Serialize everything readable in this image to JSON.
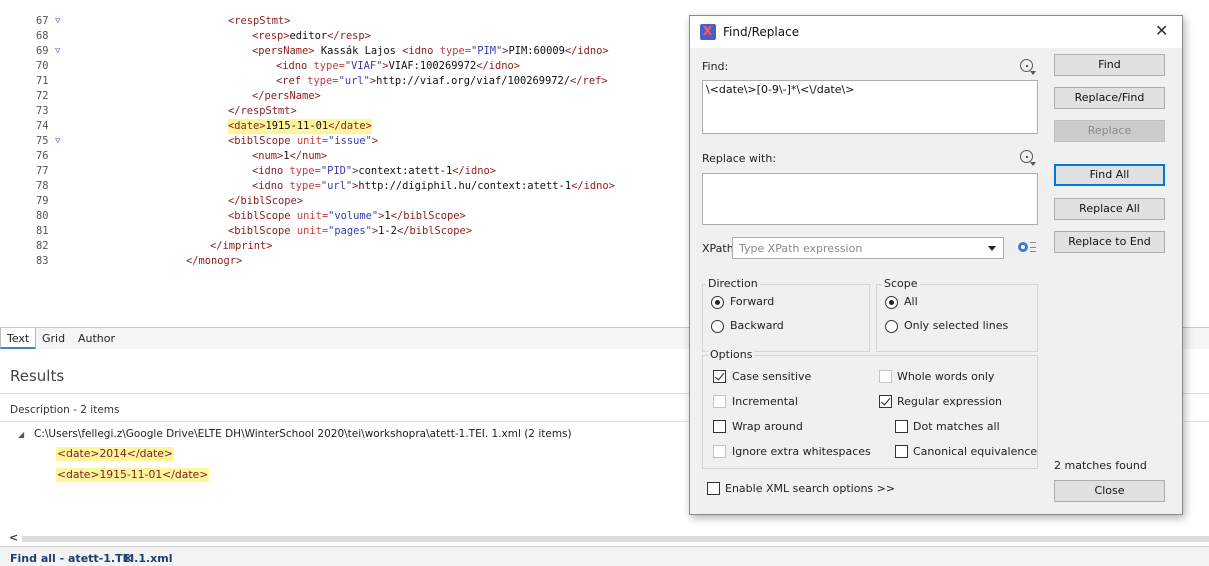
{
  "editor": {
    "lines": [
      {
        "num": "67",
        "fold": true,
        "indent": 228,
        "parts": [
          [
            "tg",
            "<respStmt>"
          ]
        ]
      },
      {
        "num": "68",
        "fold": false,
        "indent": 252,
        "parts": [
          [
            "tg",
            "<resp>"
          ],
          [
            "tx",
            "editor"
          ],
          [
            "tg",
            "</resp>"
          ]
        ]
      },
      {
        "num": "69",
        "fold": true,
        "indent": 252,
        "parts": [
          [
            "tg",
            "<persName>"
          ],
          [
            "tx",
            " Kassák Lajos "
          ],
          [
            "tg",
            "<idno "
          ],
          [
            "an",
            "type="
          ],
          [
            "av",
            "\"PIM\""
          ],
          [
            "tg",
            ">"
          ],
          [
            "tx",
            "PIM:60009"
          ],
          [
            "tg",
            "</idno>"
          ]
        ]
      },
      {
        "num": "70",
        "fold": false,
        "indent": 276,
        "parts": [
          [
            "tg",
            "<idno "
          ],
          [
            "an",
            "type="
          ],
          [
            "av",
            "\"VIAF\""
          ],
          [
            "tg",
            ">"
          ],
          [
            "tx",
            "VIAF:100269972"
          ],
          [
            "tg",
            "</idno>"
          ]
        ]
      },
      {
        "num": "71",
        "fold": false,
        "indent": 276,
        "parts": [
          [
            "tg",
            "<ref "
          ],
          [
            "an",
            "type="
          ],
          [
            "av",
            "\"url\""
          ],
          [
            "tg",
            ">"
          ],
          [
            "tx",
            "http://viaf.org/viaf/100269972/"
          ],
          [
            "tg",
            "</ref>"
          ]
        ]
      },
      {
        "num": "72",
        "fold": false,
        "indent": 252,
        "parts": [
          [
            "tg",
            "</persName>"
          ]
        ]
      },
      {
        "num": "73",
        "fold": false,
        "indent": 228,
        "parts": [
          [
            "tg",
            "</respStmt>"
          ]
        ]
      },
      {
        "num": "74",
        "fold": false,
        "indent": 228,
        "highlight": true,
        "parts": [
          [
            "tg",
            "<date>"
          ],
          [
            "tx",
            "1915-11-01"
          ],
          [
            "tg",
            "</date>"
          ]
        ]
      },
      {
        "num": "75",
        "fold": true,
        "indent": 228,
        "parts": [
          [
            "tg",
            "<biblScope "
          ],
          [
            "an",
            "unit="
          ],
          [
            "av",
            "\"issue\""
          ],
          [
            "tg",
            ">"
          ]
        ]
      },
      {
        "num": "76",
        "fold": false,
        "indent": 252,
        "parts": [
          [
            "tg",
            "<num>"
          ],
          [
            "tx",
            "1"
          ],
          [
            "tg",
            "</num>"
          ]
        ]
      },
      {
        "num": "77",
        "fold": false,
        "indent": 252,
        "parts": [
          [
            "tg",
            "<idno "
          ],
          [
            "an",
            "type="
          ],
          [
            "av",
            "\"PID\""
          ],
          [
            "tg",
            ">"
          ],
          [
            "tx",
            "context:atett-1"
          ],
          [
            "tg",
            "</idno>"
          ]
        ]
      },
      {
        "num": "78",
        "fold": false,
        "indent": 252,
        "parts": [
          [
            "tg",
            "<idno "
          ],
          [
            "an",
            "type="
          ],
          [
            "av",
            "\"url\""
          ],
          [
            "tg",
            ">"
          ],
          [
            "tx",
            "http://digiphil.hu/context:atett-1"
          ],
          [
            "tg",
            "</idno>"
          ]
        ]
      },
      {
        "num": "79",
        "fold": false,
        "indent": 228,
        "parts": [
          [
            "tg",
            "</biblScope>"
          ]
        ]
      },
      {
        "num": "80",
        "fold": false,
        "indent": 228,
        "parts": [
          [
            "tg",
            "<biblScope "
          ],
          [
            "an",
            "unit="
          ],
          [
            "av",
            "\"volume\""
          ],
          [
            "tg",
            ">"
          ],
          [
            "tx",
            "1"
          ],
          [
            "tg",
            "</biblScope>"
          ]
        ]
      },
      {
        "num": "81",
        "fold": false,
        "indent": 228,
        "parts": [
          [
            "tg",
            "<biblScope "
          ],
          [
            "an",
            "unit="
          ],
          [
            "av",
            "\"pages\""
          ],
          [
            "tg",
            ">"
          ],
          [
            "tx",
            "1-2"
          ],
          [
            "tg",
            "</biblScope>"
          ]
        ]
      },
      {
        "num": "82",
        "fold": false,
        "indent": 210,
        "parts": [
          [
            "tg",
            "</imprint>"
          ]
        ]
      },
      {
        "num": "83",
        "fold": false,
        "indent": 186,
        "parts": [
          [
            "tg",
            "</monogr>"
          ]
        ]
      }
    ]
  },
  "modes": {
    "text": "Text",
    "grid": "Grid",
    "author": "Author"
  },
  "results": {
    "title": "Results",
    "description": "Description - 2 items",
    "path": "C:\\Users\\fellegi.z\\Google Drive\\ELTE DH\\WinterSchool 2020\\tei\\workshopra\\atett-1.TEI. 1.xml (2 items)",
    "matches": [
      "<date>2014</date>",
      "<date>1915-11-01</date>"
    ]
  },
  "bottom_tab": {
    "label": "Find all - atett-1.TEI.1.xml",
    "close": "×"
  },
  "dialog": {
    "title": "Find/Replace",
    "close": "✕",
    "find_label": "Find:",
    "find_value": "\\<date\\>[0-9\\-]*\\<\\/date\\>",
    "replace_label": "Replace with:",
    "replace_value": "",
    "xpath_label": "XPath:",
    "xpath_placeholder": "Type XPath expression",
    "buttons": {
      "find": "Find",
      "replace_find": "Replace/Find",
      "replace": "Replace",
      "find_all": "Find All",
      "replace_all": "Replace All",
      "replace_to_end": "Replace to End",
      "close": "Close"
    },
    "direction": {
      "title": "Direction",
      "forward": "Forward",
      "backward": "Backward",
      "selected": "forward"
    },
    "scope": {
      "title": "Scope",
      "all": "All",
      "only_selected": "Only selected lines",
      "selected": "all"
    },
    "options": {
      "title": "Options",
      "case_sensitive": {
        "label": "Case sensitive",
        "checked": true,
        "enabled": true
      },
      "whole_words": {
        "label": "Whole words only",
        "checked": false,
        "enabled": false
      },
      "incremental": {
        "label": "Incremental",
        "checked": false,
        "enabled": false
      },
      "regular_expression": {
        "label": "Regular expression",
        "checked": true,
        "enabled": true
      },
      "wrap_around": {
        "label": "Wrap around",
        "checked": false,
        "enabled": true
      },
      "dot_matches_all": {
        "label": "Dot matches all",
        "checked": false,
        "enabled": true
      },
      "ignore_whitespace": {
        "label": "Ignore extra whitespaces",
        "checked": false,
        "enabled": false
      },
      "canonical_equivalence": {
        "label": "Canonical equivalence",
        "checked": false,
        "enabled": true
      }
    },
    "xml_options": "Enable XML search options >>",
    "status": "2 matches found"
  }
}
